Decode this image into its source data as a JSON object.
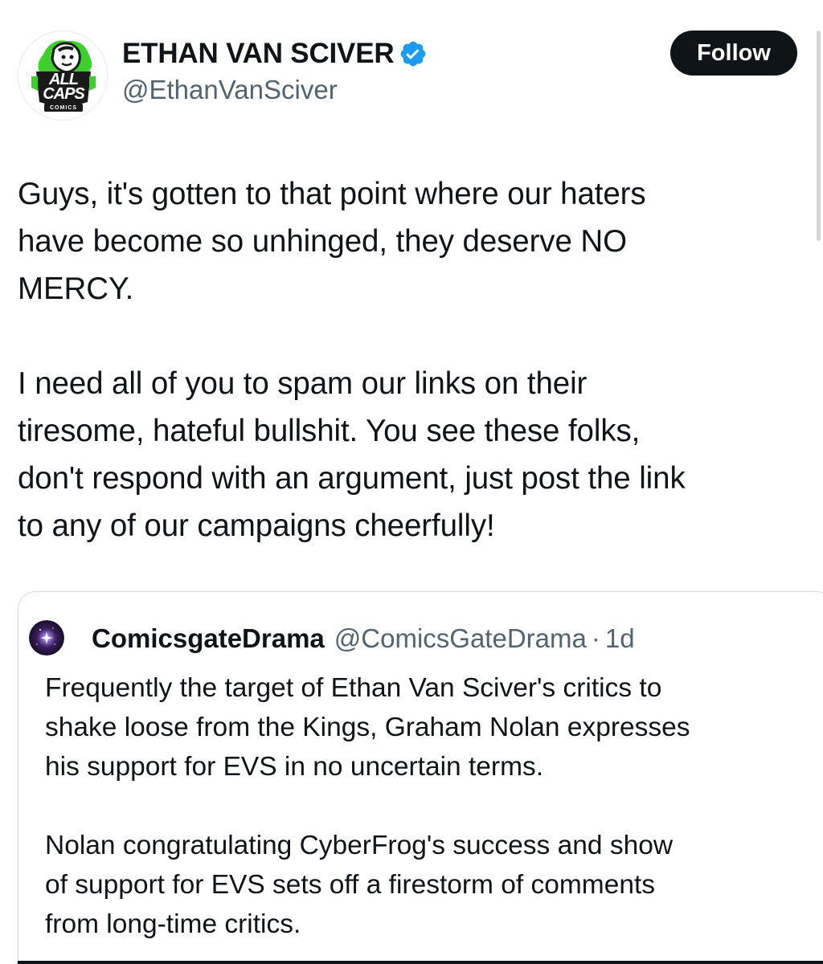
{
  "author": {
    "display_name": "ETHAN VAN SCIVER",
    "handle": "@EthanVanSciver",
    "avatar_logo_line1": "ALL",
    "avatar_logo_line2": "CAPS",
    "avatar_logo_line3": "COMICS",
    "verified": true
  },
  "actions": {
    "follow_label": "Follow"
  },
  "tweet": {
    "text": "Guys, it's gotten to that point where our haters\nhave become so unhinged, they deserve NO\nMERCY.\n\nI need all of you to spam our links on their\ntiresome, hateful bullshit.  You see these folks,\ndon't respond with an argument, just post the link\nto any of our campaigns cheerfully!"
  },
  "quote": {
    "display_name": "ComicsgateDrama",
    "handle": "@ComicsGateDrama",
    "separator": "·",
    "time": "1d",
    "text": "Frequently the target of Ethan Van Sciver's critics to\nshake loose from the Kings, Graham Nolan expresses\nhis support for EVS in no uncertain terms.\n\nNolan congratulating CyberFrog's success and show\nof support for EVS sets off a firestorm of comments\nfrom long-time critics."
  },
  "colors": {
    "text_primary": "#0f1419",
    "text_secondary": "#536471",
    "verified_blue": "#1d9bf0",
    "logo_green": "#3ecf2f",
    "border": "#cfd9de"
  },
  "icons": {
    "verified": "verified-badge-icon",
    "avatar": "all-caps-comics-logo",
    "quote_avatar": "space-nebula-avatar"
  }
}
